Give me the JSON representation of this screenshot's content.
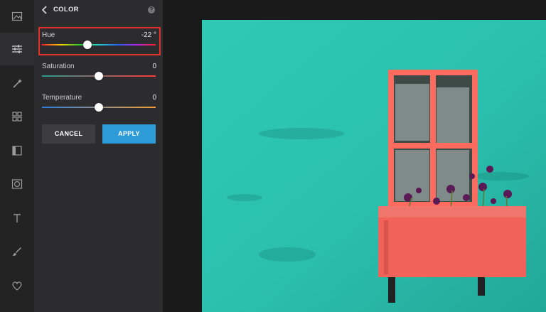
{
  "panel": {
    "title": "COLOR",
    "help_glyph": "?",
    "sliders": [
      {
        "label": "Hue",
        "value": "-22 °",
        "position": 0.4,
        "gradient": "hue",
        "highlighted": true
      },
      {
        "label": "Saturation",
        "value": "0",
        "position": 0.5,
        "gradient": "saturation",
        "highlighted": false
      },
      {
        "label": "Temperature",
        "value": "0",
        "position": 0.5,
        "gradient": "temperature",
        "highlighted": false
      }
    ],
    "buttons": {
      "cancel": "CANCEL",
      "apply": "APPLY"
    }
  },
  "tools": [
    {
      "icon": "image-icon",
      "active": false
    },
    {
      "icon": "adjust-sliders-icon",
      "active": true
    },
    {
      "icon": "magic-wand-icon",
      "active": false
    },
    {
      "icon": "grid-icon",
      "active": false
    },
    {
      "icon": "frame-icon",
      "active": false
    },
    {
      "icon": "vignette-icon",
      "active": false
    },
    {
      "icon": "text-icon",
      "active": false
    },
    {
      "icon": "brush-icon",
      "active": false
    },
    {
      "icon": "heart-icon",
      "active": false
    }
  ],
  "colors": {
    "accent": "#2e9bd9",
    "highlight": "#e2322d",
    "wall": "#2fc4b0",
    "window_frame": "#ff6b5e",
    "planter": "#f0625a"
  }
}
